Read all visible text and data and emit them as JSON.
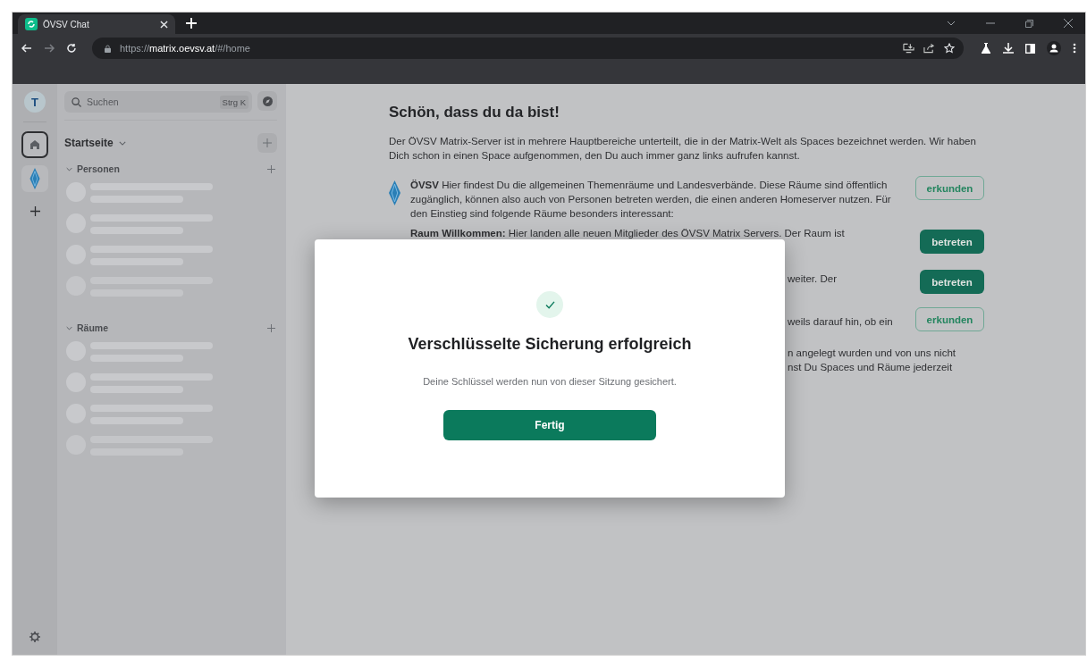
{
  "browser": {
    "tab": {
      "title": "ÖVSV Chat",
      "selected": true
    },
    "url": {
      "scheme": "https://",
      "host": "matrix.oevsv.at",
      "path": "/#/home"
    }
  },
  "space_bar": {
    "avatar_letter": "T",
    "spaces": [
      {
        "kind": "home",
        "selected": true
      },
      {
        "kind": "logo",
        "selected": false
      }
    ]
  },
  "sidebar": {
    "search": {
      "placeholder": "Suchen",
      "shortcut": "Strg K"
    },
    "title": "Startseite",
    "sections": [
      {
        "label": "Personen",
        "expanded": true
      },
      {
        "label": "Räume",
        "expanded": true
      }
    ]
  },
  "home": {
    "heading": "Schön, dass du da bist!",
    "intro": "Der ÖVSV Matrix-Server ist in mehrere Hauptbereiche unterteilt, die in der Matrix-Welt als Spaces bezeichnet werden. Wir haben Dich schon in einen Space aufgenommen, den Du auch immer ganz links aufrufen kannst.",
    "entries": [
      {
        "kind": "space",
        "cut": false,
        "text": "**ÖVSV** Hier findest Du die allgemeinen Themenräume und Landesverbände. Diese Räume sind öffentlich zugänglich, können also auch von Personen betreten werden, die einen anderen Homeserver nutzen. Für den Einstieg sind folgende Räume besonders interessant:",
        "button": "erkunden"
      },
      {
        "kind": "room",
        "cut": false,
        "text": "**Raum Willkommen:** Hier landen alle neuen Mitglieder des ÖVSV Matrix Servers. Der Raum ist",
        "button": "betreten"
      },
      {
        "kind": "room",
        "cut": true,
        "text": "weiter. Der",
        "button": "betreten"
      },
      {
        "kind": "space",
        "cut": true,
        "text": "weils darauf hin, ob ein",
        "button": "erkunden"
      },
      {
        "kind": "note",
        "cut": true,
        "text": "n angelegt wurden und von uns nicht nst Du Spaces und Räume jederzeit"
      }
    ]
  },
  "dialog": {
    "title": "Verschlüsselte Sicherung erfolgreich",
    "message": "Deine Schlüssel werden nun von dieser Sitzung gesichert.",
    "button": "Fertig"
  }
}
